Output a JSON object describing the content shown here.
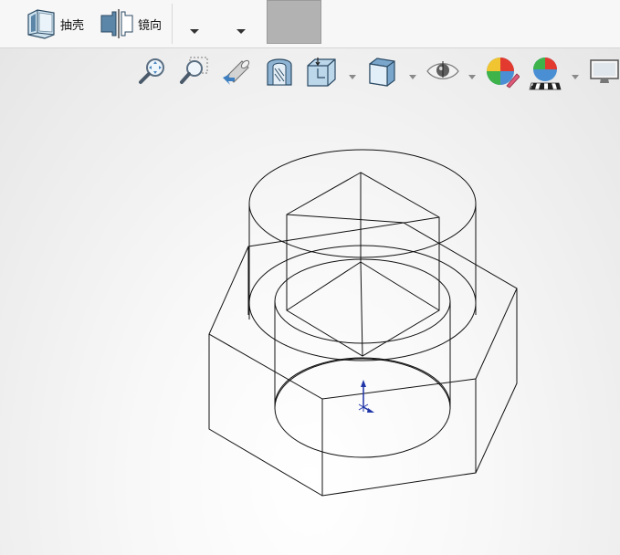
{
  "ribbon": {
    "shell_label": "抽壳",
    "mirror_label": "镜向",
    "shell_icon": "shell-icon",
    "mirror_icon": "mirror-icon",
    "swatch_color": "#b2b2b2"
  },
  "heads_up_toolbar": {
    "tools": [
      "zoom-to-fit-icon",
      "zoom-to-area-icon",
      "previous-view-icon",
      "section-view-icon",
      "view-orientation-icon",
      "display-style-icon",
      "hide-show-items-icon",
      "edit-appearance-icon",
      "apply-scene-icon",
      "view-settings-icon"
    ]
  },
  "viewport": {
    "model": "hex-nut-wireframe",
    "triad_icon": "origin-triad-icon",
    "background": "#f2f2f2"
  }
}
